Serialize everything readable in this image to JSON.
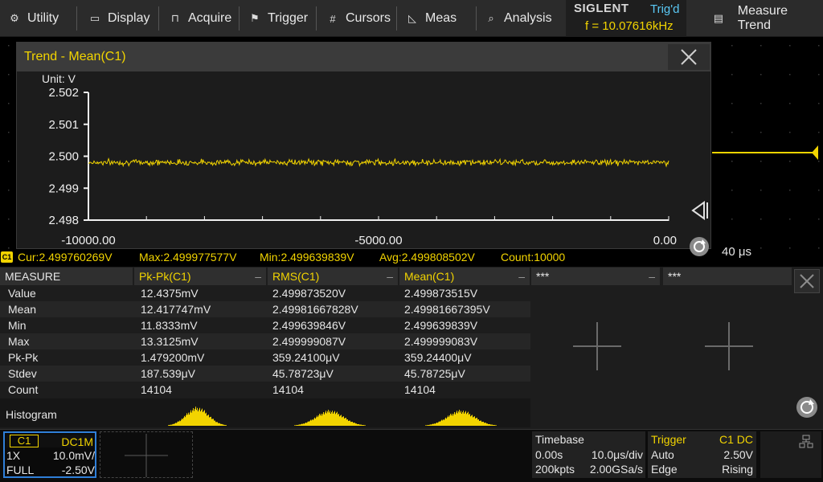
{
  "menu": {
    "items": [
      {
        "label": "Utility",
        "icon": "gear-icon"
      },
      {
        "label": "Display",
        "icon": "monitor-icon"
      },
      {
        "label": "Acquire",
        "icon": "acquire-icon"
      },
      {
        "label": "Trigger",
        "icon": "flag-icon"
      },
      {
        "label": "Cursors",
        "icon": "cursors-icon"
      },
      {
        "label": "Meas",
        "icon": "meas-icon"
      },
      {
        "label": "Analysis",
        "icon": "analysis-icon"
      }
    ],
    "brand": "SIGLENT",
    "trig_status": "Trig'd",
    "frequency": "f = 10.07616kHz",
    "right_label": "Measure Trend",
    "right_icon": "document-icon"
  },
  "trend": {
    "title": "Trend - Mean(C1)",
    "unit": "Unit: V",
    "close_icon": "close-icon"
  },
  "chart_data": {
    "type": "line",
    "title": "Trend - Mean(C1)",
    "xlabel": "",
    "ylabel": "Unit: V",
    "xlim": [
      -10000,
      0
    ],
    "ylim": [
      2.498,
      2.502
    ],
    "x_ticks": [
      "-10000.00",
      "-5000.00",
      "0.00"
    ],
    "y_ticks": [
      "2.502",
      "2.501",
      "2.500",
      "2.499",
      "2.498"
    ],
    "series": [
      {
        "name": "Mean(C1)",
        "color": "#f2d400",
        "mean": 2.499808502,
        "min": 2.499639839,
        "max": 2.499977577,
        "count": 10000
      }
    ],
    "grid": false
  },
  "stats": {
    "cur": "Cur:2.499760269V",
    "max": "Max:2.499977577V",
    "min": "Min:2.499639839V",
    "avg": "Avg:2.499808502V",
    "count": "Count:10000",
    "chip": "C1"
  },
  "timebase_readout": "40 μs",
  "measure": {
    "header": "MEASURE",
    "columns": [
      "Pk-Pk(C1)",
      "RMS(C1)",
      "Mean(C1)",
      "***",
      "***"
    ],
    "rows": [
      {
        "label": "Value",
        "cells": [
          "12.4375mV",
          "2.499873520V",
          "2.499873515V"
        ]
      },
      {
        "label": "Mean",
        "cells": [
          "12.417747mV",
          "2.49981667828V",
          "2.49981667395V"
        ]
      },
      {
        "label": "Min",
        "cells": [
          "11.8333mV",
          "2.499639846V",
          "2.499639839V"
        ]
      },
      {
        "label": "Max",
        "cells": [
          "13.3125mV",
          "2.499999087V",
          "2.499999083V"
        ]
      },
      {
        "label": "Pk-Pk",
        "cells": [
          "1.479200mV",
          "359.24100μV",
          "359.24400μV"
        ]
      },
      {
        "label": "Stdev",
        "cells": [
          "187.539μV",
          "45.78723μV",
          "45.78725μV"
        ]
      },
      {
        "label": "Count",
        "cells": [
          "14104",
          "14104",
          "14104"
        ]
      }
    ],
    "histogram_label": "Histogram",
    "accent": "#f2d400"
  },
  "channel": {
    "name": "C1",
    "coupling": "DC1M",
    "probe": "1X",
    "scale": "10.0mV/",
    "bandwidth": "FULL",
    "offset": "-2.50V",
    "border_color": "#2f7fd8"
  },
  "timebase": {
    "title": "Timebase",
    "delay": "0.00s",
    "scale": "10.0μs/div",
    "memory": "200kpts",
    "rate": "2.00GSa/s"
  },
  "trigger": {
    "title": "Trigger",
    "source": "C1 DC",
    "mode": "Auto",
    "level": "2.50V",
    "type": "Edge",
    "slope": "Rising"
  }
}
